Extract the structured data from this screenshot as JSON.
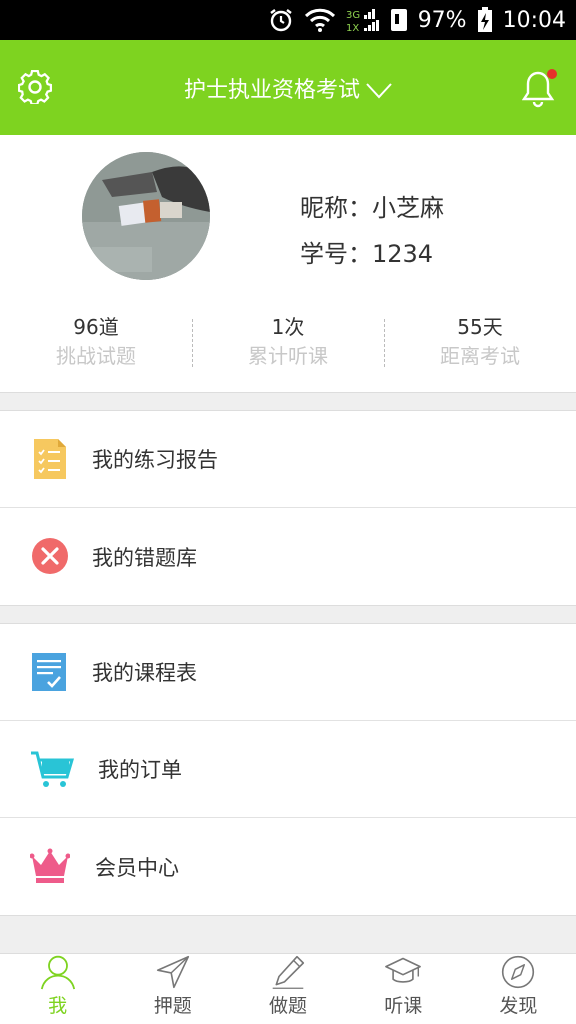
{
  "status_bar": {
    "network": "3G 1X",
    "battery": "97%",
    "time": "10:04"
  },
  "header": {
    "title": "护士执业资格考试",
    "settings_icon": "gear-icon",
    "notification_icon": "bell-icon",
    "accent_color": "#7ed320",
    "badge_color": "#e5332a"
  },
  "profile": {
    "nickname_line": "昵称：小芝麻",
    "student_id_line": "学号：1234",
    "stats": [
      {
        "value": "96道",
        "label": "挑战试题"
      },
      {
        "value": "1次",
        "label": "累计听课"
      },
      {
        "value": "55天",
        "label": "距离考试"
      }
    ]
  },
  "menu": {
    "group1": [
      {
        "label": "我的练习报告",
        "icon": "report-icon"
      },
      {
        "label": "我的错题库",
        "icon": "wrong-questions-icon"
      }
    ],
    "group2": [
      {
        "label": "我的课程表",
        "icon": "schedule-icon"
      },
      {
        "label": "我的订单",
        "icon": "cart-icon"
      },
      {
        "label": "会员中心",
        "icon": "crown-icon"
      }
    ]
  },
  "tabs": [
    {
      "label": "我",
      "icon": "user-icon",
      "active": true
    },
    {
      "label": "押题",
      "icon": "navigation-arrow-icon"
    },
    {
      "label": "做题",
      "icon": "pencil-icon"
    },
    {
      "label": "听课",
      "icon": "graduation-cap-icon"
    },
    {
      "label": "发现",
      "icon": "compass-icon"
    }
  ]
}
